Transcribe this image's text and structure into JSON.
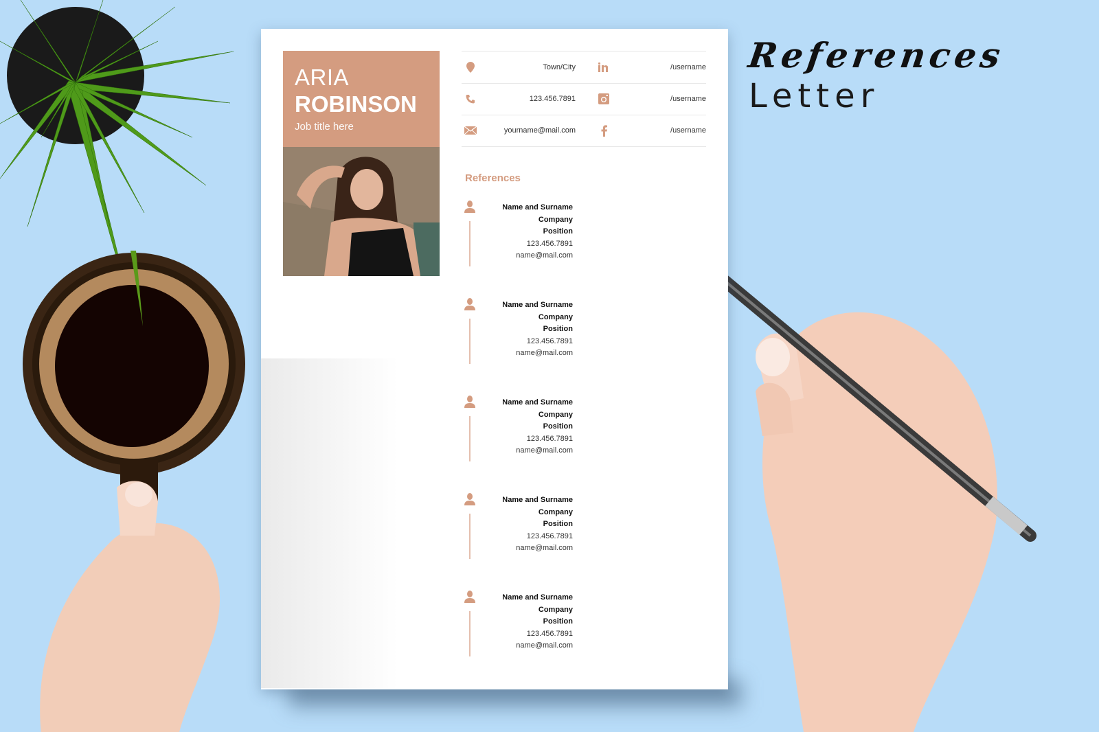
{
  "hero": {
    "script_title": "References",
    "subtitle": "Letter"
  },
  "resume": {
    "first_name": "ARIA",
    "last_name": "ROBINSON",
    "job_title": "Job title here",
    "accent_color": "#d49c80",
    "contact": [
      {
        "icon": "location-pin-icon",
        "text": "Town/City",
        "social_icon": "linkedin-icon",
        "social_text": "/username"
      },
      {
        "icon": "phone-icon",
        "text": "123.456.7891",
        "social_icon": "instagram-icon",
        "social_text": "/username"
      },
      {
        "icon": "envelope-icon",
        "text": "yourname@mail.com",
        "social_icon": "facebook-icon",
        "social_text": "/username"
      }
    ],
    "references_heading": "References",
    "references": [
      {
        "name": "Name and Surname",
        "company": "Company",
        "position": "Position",
        "phone": "123.456.7891",
        "email": "name@mail.com"
      },
      {
        "name": "Name and Surname",
        "company": "Company",
        "position": "Position",
        "phone": "123.456.7891",
        "email": "name@mail.com"
      },
      {
        "name": "Name and Surname",
        "company": "Company",
        "position": "Position",
        "phone": "123.456.7891",
        "email": "name@mail.com"
      },
      {
        "name": "Name and Surname",
        "company": "Company",
        "position": "Position",
        "phone": "123.456.7891",
        "email": "name@mail.com"
      },
      {
        "name": "Name and Surname",
        "company": "Company",
        "position": "Position",
        "phone": "123.456.7891",
        "email": "name@mail.com"
      }
    ]
  }
}
